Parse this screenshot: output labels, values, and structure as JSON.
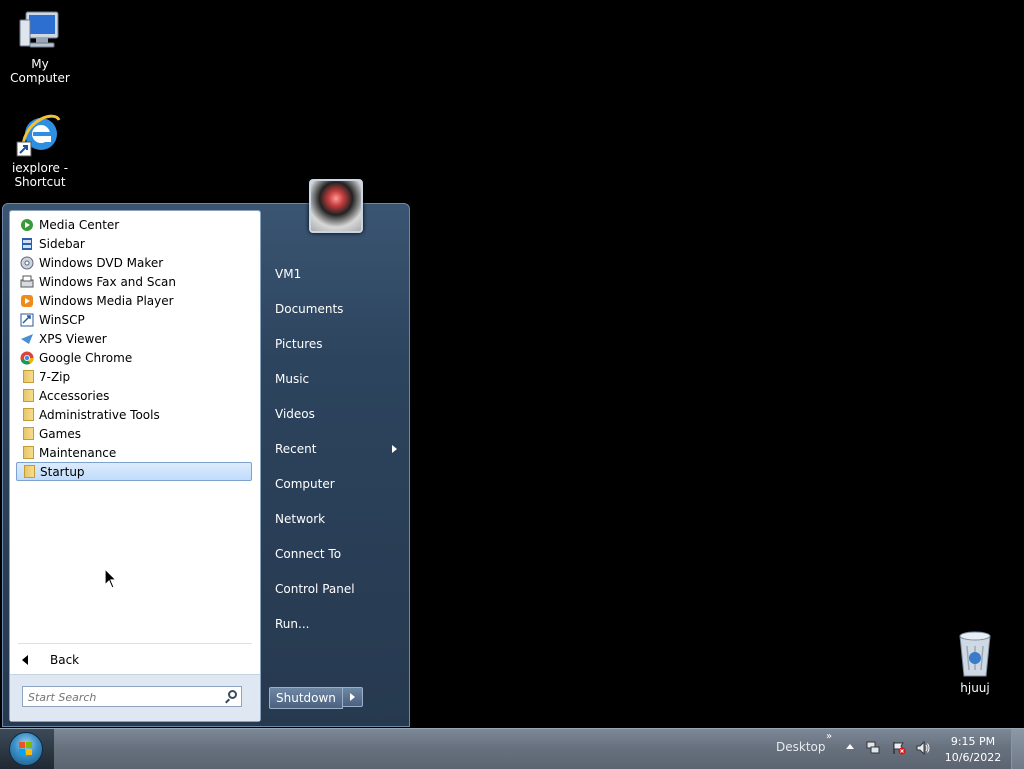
{
  "desktop": {
    "icons": [
      {
        "label": "My Computer"
      },
      {
        "label": "iexplore - Shortcut"
      },
      {
        "label": "hjuuj"
      }
    ]
  },
  "start_menu": {
    "programs": [
      {
        "label": "Media Center",
        "icon": "media-center-icon"
      },
      {
        "label": "Sidebar",
        "icon": "sidebar-icon"
      },
      {
        "label": "Windows DVD Maker",
        "icon": "dvd-maker-icon"
      },
      {
        "label": "Windows Fax and Scan",
        "icon": "fax-scan-icon"
      },
      {
        "label": "Windows Media Player",
        "icon": "media-player-icon"
      },
      {
        "label": "WinSCP",
        "icon": "winscp-icon"
      },
      {
        "label": "XPS Viewer",
        "icon": "xps-viewer-icon"
      },
      {
        "label": "Google Chrome",
        "icon": "chrome-icon"
      },
      {
        "label": "7-Zip",
        "icon": "folder-icon"
      },
      {
        "label": "Accessories",
        "icon": "folder-icon"
      },
      {
        "label": "Administrative Tools",
        "icon": "folder-icon"
      },
      {
        "label": "Games",
        "icon": "folder-icon"
      },
      {
        "label": "Maintenance",
        "icon": "folder-icon"
      },
      {
        "label": "Startup",
        "icon": "folder-icon",
        "selected": true
      }
    ],
    "back_label": "Back",
    "search_placeholder": "Start Search",
    "right_items": [
      {
        "label": "VM1"
      },
      {
        "label": "Documents"
      },
      {
        "label": "Pictures"
      },
      {
        "label": "Music"
      },
      {
        "label": "Videos"
      },
      {
        "label": "Recent",
        "has_submenu": true
      },
      {
        "label": "Computer"
      },
      {
        "label": "Network"
      },
      {
        "label": "Connect To"
      },
      {
        "label": "Control Panel"
      },
      {
        "label": "Run..."
      }
    ],
    "shutdown_label": "Shutdown"
  },
  "taskbar": {
    "toolbar_label": "Desktop",
    "chevron": "»",
    "time": "9:15 PM",
    "date": "10/6/2022"
  }
}
